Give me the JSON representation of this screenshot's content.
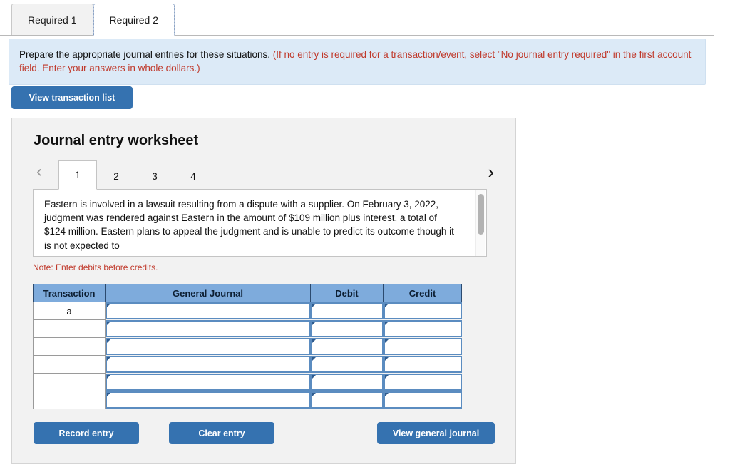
{
  "required_tabs": [
    {
      "label": "Required 1",
      "active": false
    },
    {
      "label": "Required 2",
      "active": true
    }
  ],
  "instructions": {
    "main": "Prepare the appropriate journal entries for these situations.",
    "hint": "(If no entry is required for a transaction/event, select \"No journal entry required\" in the first account field. Enter your answers in whole dollars.)"
  },
  "toolbar": {
    "view_transaction_list": "View transaction list"
  },
  "worksheet": {
    "title": "Journal entry worksheet",
    "pager": {
      "prev_icon": "‹",
      "next_icon": "›",
      "pages": [
        {
          "label": "1",
          "active": true
        },
        {
          "label": "2",
          "active": false
        },
        {
          "label": "3",
          "active": false
        },
        {
          "label": "4",
          "active": false
        }
      ]
    },
    "scenario": "Eastern is involved in a lawsuit resulting from a dispute with a supplier. On February 3, 2022, judgment was rendered against Eastern in the amount of $109 million plus interest, a total of $124 million. Eastern plans to appeal the judgment and is unable to predict its outcome though it is not expected to",
    "note": "Note: Enter debits before credits.",
    "table": {
      "headers": [
        "Transaction",
        "General Journal",
        "Debit",
        "Credit"
      ],
      "rows": [
        {
          "transaction": "a",
          "general_journal": "",
          "debit": "",
          "credit": ""
        },
        {
          "transaction": "",
          "general_journal": "",
          "debit": "",
          "credit": ""
        },
        {
          "transaction": "",
          "general_journal": "",
          "debit": "",
          "credit": ""
        },
        {
          "transaction": "",
          "general_journal": "",
          "debit": "",
          "credit": ""
        },
        {
          "transaction": "",
          "general_journal": "",
          "debit": "",
          "credit": ""
        },
        {
          "transaction": "",
          "general_journal": "",
          "debit": "",
          "credit": ""
        }
      ]
    },
    "actions": {
      "record_entry": "Record entry",
      "clear_entry": "Clear entry",
      "view_general_journal": "View general journal"
    }
  },
  "colors": {
    "button_blue": "#3572b0",
    "banner_blue": "#dceaf7",
    "header_blue": "#7eabdc",
    "red_text": "#c0392b",
    "input_border": "#5b8cc0"
  }
}
